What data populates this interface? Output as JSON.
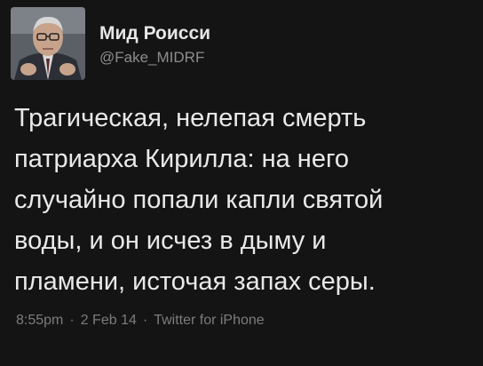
{
  "author": {
    "name": "Мид Роисси",
    "handle": "@Fake_MIDRF"
  },
  "tweet": {
    "lines": [
      "Трагическая, нелепая смерть",
      "патриарха Кирилла: на него",
      "случайно попали капли святой",
      "воды, и он исчез в дыму и",
      "пламени, источая запах серы."
    ]
  },
  "meta": {
    "time": "8:55pm",
    "date": "2 Feb 14",
    "source": "Twitter for iPhone",
    "separator": "·"
  },
  "colors": {
    "background": "#141414",
    "text": "#e9e9e9",
    "secondary": "#8d8d8d"
  }
}
